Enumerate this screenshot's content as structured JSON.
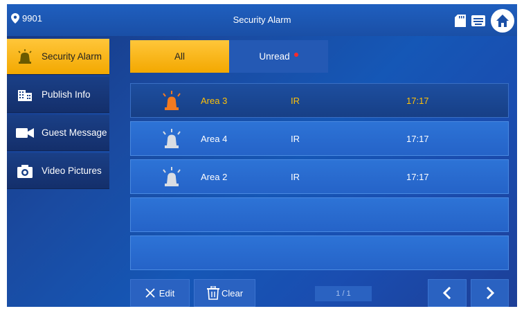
{
  "header": {
    "location_code": "9901",
    "title": "Security Alarm"
  },
  "sidebar": {
    "items": [
      {
        "label": "Security Alarm",
        "icon": "alarm-icon",
        "active": true
      },
      {
        "label": "Publish Info",
        "icon": "building-icon",
        "active": false
      },
      {
        "label": "Guest Message",
        "icon": "video-camera-icon",
        "active": false
      },
      {
        "label": "Video Pictures",
        "icon": "camera-icon",
        "active": false
      }
    ]
  },
  "tabs": [
    {
      "label": "All",
      "active": true
    },
    {
      "label": "Unread",
      "active": false,
      "has_unread_dot": true
    }
  ],
  "alarms": [
    {
      "area": "Area 3",
      "type": "IR",
      "time": "17:17",
      "selected": true
    },
    {
      "area": "Area 4",
      "type": "IR",
      "time": "17:17",
      "selected": false
    },
    {
      "area": "Area 2",
      "type": "IR",
      "time": "17:17",
      "selected": false
    }
  ],
  "toolbar": {
    "edit_label": "Edit",
    "clear_label": "Clear",
    "page_indicator": "1 / 1"
  },
  "colors": {
    "accent_yellow": "#f3a800",
    "selected_text": "#ffc107",
    "alarm_active": "#f47a20",
    "alarm_inactive": "#d9dde3",
    "background_blue": "#1557b6"
  }
}
